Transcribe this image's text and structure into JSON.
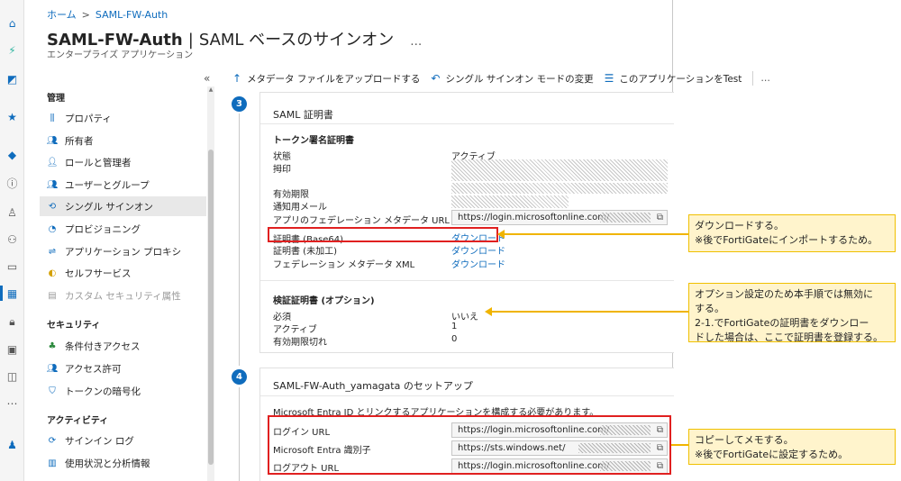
{
  "breadcrumb": {
    "home": "ホーム",
    "separator": ">",
    "current": "SAML-FW-Auth"
  },
  "header": {
    "app_name": "SAML-FW-Auth",
    "divider": "|",
    "page": "SAML ベースのサインオン",
    "more": "…",
    "subtitle": "エンタープライズ アプリケーション"
  },
  "nav": {
    "collapse": "«",
    "sections": [
      {
        "label": "管理",
        "items": [
          {
            "label": "プロパティ",
            "icon": "properties-icon"
          },
          {
            "label": "所有者",
            "icon": "owners-icon"
          },
          {
            "label": "ロールと管理者",
            "icon": "roles-icon"
          },
          {
            "label": "ユーザーとグループ",
            "icon": "users-groups-icon"
          },
          {
            "label": "シングル サインオン",
            "icon": "sso-icon",
            "selected": true
          },
          {
            "label": "プロビジョニング",
            "icon": "provisioning-icon"
          },
          {
            "label": "アプリケーション プロキシ",
            "icon": "app-proxy-icon"
          },
          {
            "label": "セルフサービス",
            "icon": "self-service-icon"
          },
          {
            "label": "カスタム セキュリティ属性",
            "icon": "custom-attr-icon",
            "disabled": true
          }
        ]
      },
      {
        "label": "セキュリティ",
        "items": [
          {
            "label": "条件付きアクセス",
            "icon": "conditional-access-icon"
          },
          {
            "label": "アクセス許可",
            "icon": "permissions-icon"
          },
          {
            "label": "トークンの暗号化",
            "icon": "token-encryption-icon"
          }
        ]
      },
      {
        "label": "アクティビティ",
        "items": [
          {
            "label": "サインイン ログ",
            "icon": "signin-log-icon"
          },
          {
            "label": "使用状況と分析情報",
            "icon": "usage-insights-icon"
          }
        ]
      }
    ]
  },
  "toolbar": {
    "upload": "メタデータ ファイルをアップロードする",
    "change_mode": "シングル サインオン モードの変更",
    "test": "このアプリケーションをTest",
    "more": "…"
  },
  "step3": {
    "number": "3",
    "title": "SAML 証明書",
    "token_section": "トークン署名証明書",
    "status_label": "状態",
    "status_value": "アクティブ",
    "thumbprint_label": "拇印",
    "expiry_label": "有効期限",
    "notify_label": "通知用メール",
    "metadata_url_label": "アプリのフェデレーション メタデータ URL",
    "metadata_url_value": "https://login.microsoftonline.com/",
    "cert_base64_label": "証明書 (Base64)",
    "cert_raw_label": "証明書 (未加工)",
    "fed_xml_label": "フェデレーション メタデータ XML",
    "download": "ダウンロード",
    "verify_section": "検証証明書 (オプション)",
    "required_label": "必須",
    "required_value": "いいえ",
    "active_label": "アクティブ",
    "active_value": "1",
    "expired_label": "有効期限切れ",
    "expired_value": "0"
  },
  "step4": {
    "number": "4",
    "title": "SAML-FW-Auth_yamagata のセットアップ",
    "description": "Microsoft Entra ID とリンクするアプリケーションを構成する必要があります。",
    "login_url_label": "ログイン URL",
    "login_url_value": "https://login.microsoftonline.com/",
    "entra_id_label": "Microsoft Entra 識別子",
    "entra_id_value": "https://sts.windows.net/",
    "logout_url_label": "ログアウト URL",
    "logout_url_value": "https://login.microsoftonline.com/"
  },
  "callouts": {
    "download": [
      "ダウンロードする。",
      "※後でFortiGateにインポートするため。"
    ],
    "optional": [
      "オプション設定のため本手順では無効に",
      "する。",
      "2-1.でFortiGateの証明書をダウンロー",
      "ドした場合は、ここで証明書を登録する。"
    ],
    "copy": [
      "コピーしてメモする。",
      "※後でFortiGateに設定するため。"
    ]
  },
  "colors": {
    "accent": "#0f6cbd",
    "highlight": "#e02020",
    "callout_bg": "#fff4cc",
    "callout_border": "#f0c000"
  }
}
